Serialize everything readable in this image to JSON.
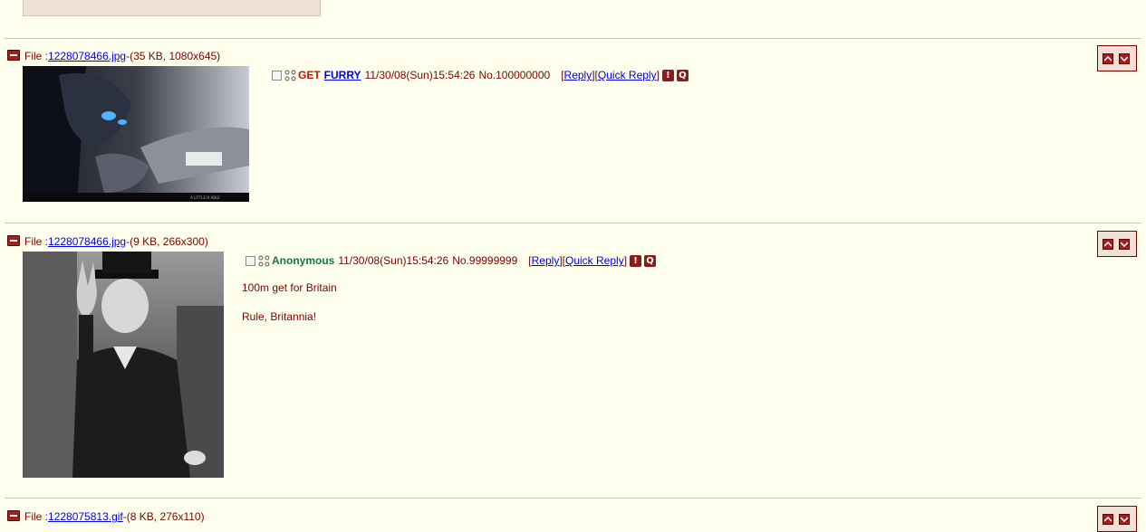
{
  "posts": [
    {
      "file_prefix": "File :",
      "file_link": "1228078466.jpg",
      "file_info": "-(35 KB, 1080x645)",
      "subject": "GET",
      "name": "FURRY",
      "datetime": "11/30/08(Sun)15:54:26",
      "post_no": "No.100000000",
      "reply_label": "Reply",
      "quick_reply_label": "Quick Reply",
      "thumbnail_caption": "A LITTLE N ABLE"
    },
    {
      "file_prefix": "File :",
      "file_link": "1228078466.jpg",
      "file_info": "-(9 KB, 266x300)",
      "name": "Anonymous",
      "datetime": "11/30/08(Sun)15:54:26",
      "post_no": "No.99999999",
      "reply_label": "Reply",
      "quick_reply_label": "Quick Reply",
      "message_lines": [
        "100m get for Britain",
        "Rule, Britannia!"
      ]
    },
    {
      "file_prefix": "File :",
      "file_link": "1228075813.gif",
      "file_info": "-(8 KB, 276x110)"
    }
  ],
  "icons": {
    "report": "!",
    "quote": "Q",
    "minus": "collapse-icon",
    "up": "arrow-up-icon",
    "down": "arrow-down-icon"
  },
  "colors": {
    "background": "#ffffee",
    "text": "#800000",
    "link": "#0000ee",
    "name_green": "#117743",
    "subject_red": "#cc1105"
  }
}
